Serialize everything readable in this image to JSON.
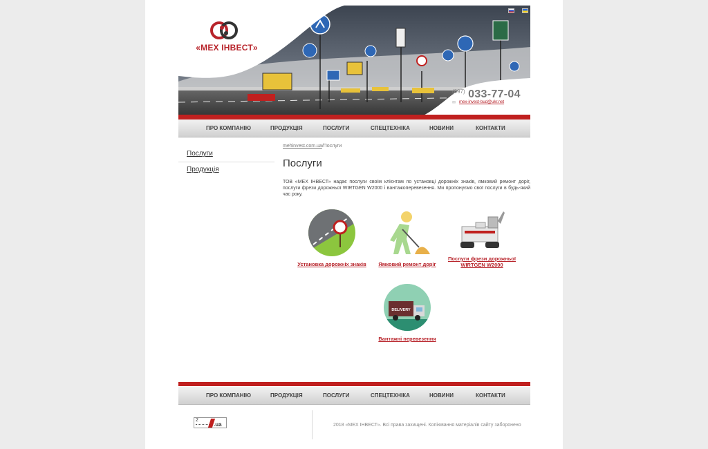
{
  "logo": {
    "name": "«МЕХ ІНВЕСТ»"
  },
  "header": {
    "phone_code": "(097)",
    "phone_number": "033-77-04",
    "email": "mex-invest-bud@ukr.net",
    "languages": [
      "ru",
      "ua"
    ]
  },
  "nav": [
    {
      "label": "ПРО КОМПАНІЮ"
    },
    {
      "label": "ПРОДУКЦІЯ"
    },
    {
      "label": "ПОСЛУГИ"
    },
    {
      "label": "СПЕЦТЕХНІКА"
    },
    {
      "label": "НОВИНИ"
    },
    {
      "label": "КОНТАКТИ"
    }
  ],
  "sidebar": {
    "items": [
      {
        "label": "Послуги"
      },
      {
        "label": "Продукція"
      }
    ]
  },
  "breadcrumb": {
    "home": "mehinvest.com.ua",
    "separator": "/",
    "current": "Послуги"
  },
  "page_title": "Послуги",
  "intro": "ТОВ «МЕХ ІНВЕСТ» надає послуги своїм клієнтам по установці дорожніх знаків, ямковий ремонт доріг, послуги фрези дорожньої WIRTGEN W2000 і вантажоперевезення. Ми пропонуємо свої послуги в будь-який час року.",
  "services": [
    {
      "label": "Установка дорожніх знаків",
      "icon": "road-sign-icon"
    },
    {
      "label": "Ямковий ремонт доріг",
      "icon": "road-worker-icon"
    },
    {
      "label": "Послуги фрези дорожньої WIRTGEN W2000",
      "icon": "milling-machine-image"
    },
    {
      "label": "Вантажні перевезення",
      "icon": "delivery-truck-icon",
      "badge": "DELIVERY"
    }
  ],
  "counter": {
    "number": "2",
    "suffix": ".ua"
  },
  "footer": {
    "copyright": "2018 «МЕХ ІНВЕСТ». Всі права захищені. Копіювання матеріалів сайту заборонено"
  },
  "colors": {
    "brand_red": "#b8242b",
    "nav_bg": "#d8d8d8",
    "page_bg": "#ececec"
  }
}
